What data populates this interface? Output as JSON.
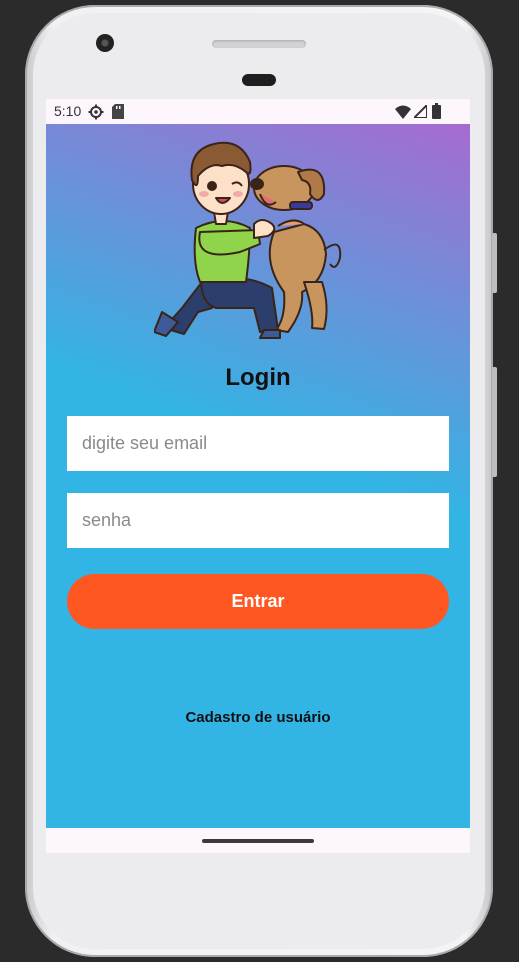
{
  "status_bar": {
    "time": "5:10"
  },
  "login": {
    "title": "Login",
    "email_placeholder": "digite seu email",
    "password_placeholder": "senha",
    "submit_label": "Entrar",
    "signup_link": "Cadastro de usuário"
  },
  "colors": {
    "background_top": "#a66bd0",
    "background_main": "#32b4e4",
    "button": "#ff5722",
    "input_bg": "#ffffff"
  }
}
